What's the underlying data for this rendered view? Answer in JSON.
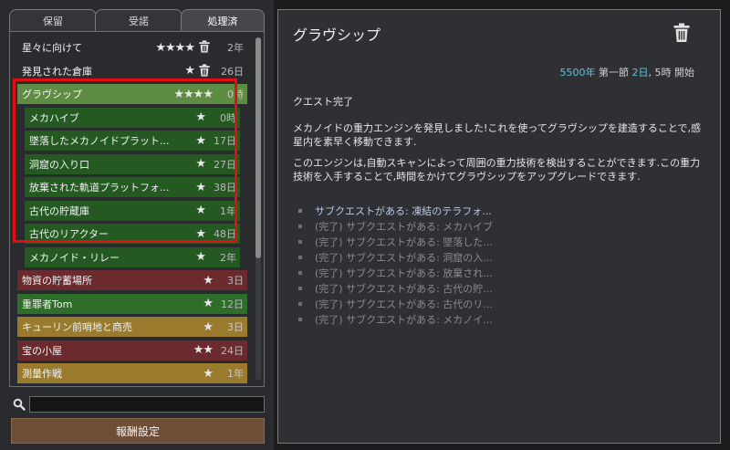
{
  "tabs": [
    {
      "label": "保留",
      "active": false
    },
    {
      "label": "受諾",
      "active": false
    },
    {
      "label": "処理済",
      "active": true
    }
  ],
  "quests": [
    {
      "title": "星々に向けて",
      "stars": "★★★★",
      "trash": true,
      "time": "2年",
      "style": "plain"
    },
    {
      "title": "発見された倉庫",
      "stars": "★",
      "trash": true,
      "time": "26日",
      "style": "plain"
    },
    {
      "title": "グラヴシップ",
      "stars": "★★★★",
      "trash": false,
      "time": "0時",
      "style": "selected"
    },
    {
      "title": "メカハイブ",
      "stars": "★",
      "trash": false,
      "time": "0時",
      "style": "dkgreen"
    },
    {
      "title": "墜落したメカノイドプラット...",
      "stars": "★",
      "trash": false,
      "time": "17日",
      "style": "dkgreen"
    },
    {
      "title": "洞窟の入り口",
      "stars": "★",
      "trash": false,
      "time": "27日",
      "style": "dkgreen"
    },
    {
      "title": "放棄された軌道プラットフォ...",
      "stars": "★",
      "trash": false,
      "time": "38日",
      "style": "dkgreen"
    },
    {
      "title": "古代の貯蔵庫",
      "stars": "★",
      "trash": false,
      "time": "1年",
      "style": "dkgreen"
    },
    {
      "title": "古代のリアクター",
      "stars": "★",
      "trash": false,
      "time": "48日",
      "style": "dkgreen"
    },
    {
      "title": "メカノイド・リレー",
      "stars": "★",
      "trash": false,
      "time": "2年",
      "style": "dkgreen"
    },
    {
      "title": "物資の貯蓄場所",
      "stars": "★",
      "trash": false,
      "time": "3日",
      "style": "red"
    },
    {
      "title": "重罪者Tom",
      "stars": "★",
      "trash": false,
      "time": "12日",
      "style": "green"
    },
    {
      "title": "キューリン前哨地と商売",
      "stars": "★",
      "trash": false,
      "time": "3日",
      "style": "gold"
    },
    {
      "title": "宝の小屋",
      "stars": "★★",
      "trash": false,
      "time": "24日",
      "style": "red"
    },
    {
      "title": "測量作戦",
      "stars": "★",
      "trash": false,
      "time": "1年",
      "style": "gold"
    }
  ],
  "search": {
    "placeholder": "",
    "value": ""
  },
  "reward_button": {
    "label": "報酬設定"
  },
  "detail": {
    "title": "グラヴシップ",
    "date": {
      "year": "5500年",
      "quadrum": "第一節",
      "day": "2日",
      "hour": "5時",
      "suffix": "開始"
    },
    "status": "クエスト完了",
    "description_1": "メカノイドの重力エンジンを発見しました!これを使ってグラヴシップを建造することで,感星内を素早く移動できます.",
    "description_2": "このエンジンは,自動スキャンによって周囲の重力技術を検出することができます.この重力技術を入手することで,時間をかけてグラヴシップをアップグレードできます.",
    "subquests": [
      {
        "text": "サブクエストがある: 凍結のテラフォ...",
        "active": true
      },
      {
        "text": "(完了) サブクエストがある: メカハイブ",
        "active": false
      },
      {
        "text": "(完了) サブクエストがある: 墜落した...",
        "active": false
      },
      {
        "text": "(完了) サブクエストがある: 洞窟の入...",
        "active": false
      },
      {
        "text": "(完了) サブクエストがある: 放棄され...",
        "active": false
      },
      {
        "text": "(完了) サブクエストがある: 古代の貯...",
        "active": false
      },
      {
        "text": "(完了) サブクエストがある: 古代のリ...",
        "active": false
      },
      {
        "text": "(完了) サブクエストがある: メカノイ...",
        "active": false
      }
    ]
  },
  "colors": {
    "selected_row": "#5e8c43",
    "green_row": "#245a22",
    "red_row": "#6b2a2d",
    "gold_row": "#9a7a2c",
    "highlight": "#e10e12",
    "accent": "#5ec4dc"
  }
}
